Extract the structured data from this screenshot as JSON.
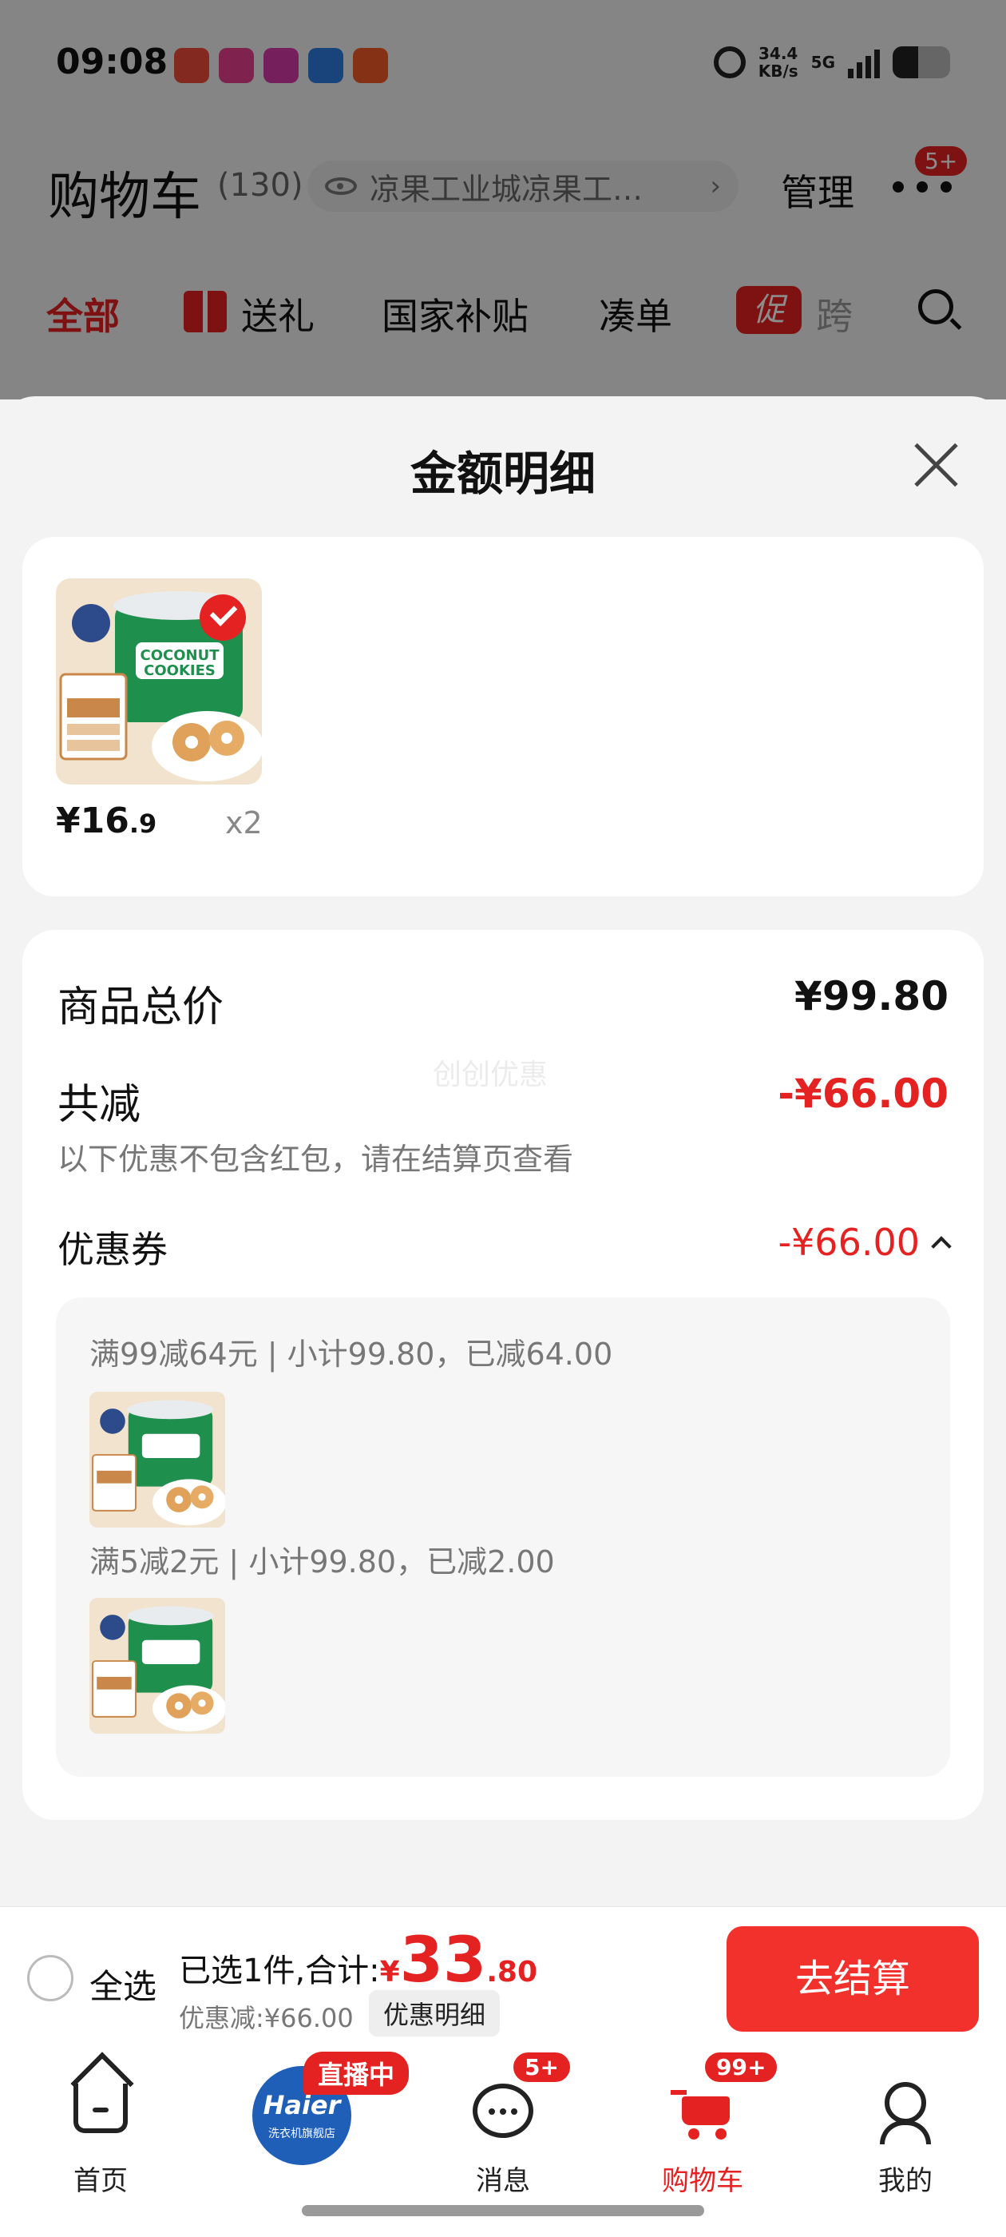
{
  "status_bar": {
    "time": "09:08",
    "net_speed_value": "34.4",
    "net_speed_unit": "KB/s",
    "network": "5G",
    "app_icon_colors": [
      "#f04b3a",
      "#e83e8c",
      "#d63aa8",
      "#2f7de1",
      "#f05a28"
    ]
  },
  "cart_header": {
    "title": "购物车",
    "count": "(130)",
    "address": "凉果工业城凉果工…",
    "manage": "管理",
    "more_badge": "5+"
  },
  "tabs": [
    {
      "label": "全部",
      "active": true
    },
    {
      "label": "送礼"
    },
    {
      "label": "国家补贴"
    },
    {
      "label": "凑单"
    },
    {
      "label": "促",
      "icon": true
    },
    {
      "label": "跨"
    }
  ],
  "sheet": {
    "title": "金额明细",
    "product": {
      "price_main": "¥16",
      "price_cents": ".9",
      "quantity": "x2",
      "image_colors": {
        "tub": "#1f8f4e",
        "lid": "#e9ecef",
        "cookie": "#e0a25a",
        "box": "#f2e3cf"
      }
    },
    "summary": {
      "total_label": "商品总价",
      "total_value": "¥99.80",
      "reduce_label": "共减",
      "reduce_value": "-¥66.00",
      "note": "以下优惠不包含红包，请在结算页查看",
      "coupon_label": "优惠券",
      "coupon_value": "-¥66.00",
      "watermark": "创创优惠"
    },
    "coupons": [
      {
        "line": "满99减64元 | 小计99.80，已减64.00"
      },
      {
        "line": "满5减2元 | 小计99.80，已减2.00"
      }
    ]
  },
  "bottom_bar": {
    "select_all": "全选",
    "selected_prefix": "已选1件,合计:",
    "yen": "¥",
    "total_big": "33",
    "total_cents": ".80",
    "discount": "优惠减:¥66.00",
    "detail": "优惠明细",
    "checkout": "去结算"
  },
  "tab_bar": {
    "home": "首页",
    "haier_logo": "Haier",
    "haier_sub": "洗衣机旗舰店",
    "live_badge": "直播中",
    "messages": "消息",
    "messages_badge": "5+",
    "cart": "购物车",
    "cart_badge": "99+",
    "me": "我的"
  },
  "colors": {
    "accent_red": "#e52222",
    "checkout_red": "#f2302c",
    "haier_blue": "#1f5fb8"
  }
}
